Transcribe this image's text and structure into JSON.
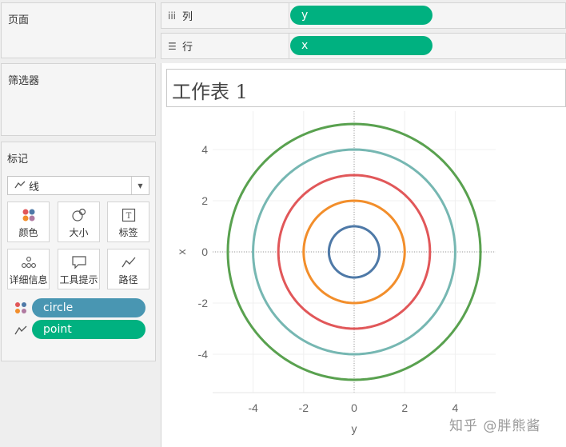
{
  "pages_card": {
    "title": "页面"
  },
  "filters_card": {
    "title": "筛选器"
  },
  "marks_card": {
    "title": "标记",
    "mark_type": "线",
    "mark_type_icon": "line-icon",
    "buttons": [
      {
        "label": "颜色",
        "icon": "color-dots-icon"
      },
      {
        "label": "大小",
        "icon": "size-icon"
      },
      {
        "label": "标签",
        "icon": "label-icon"
      },
      {
        "label": "详细信息",
        "icon": "detail-icon"
      },
      {
        "label": "工具提示",
        "icon": "tooltip-icon"
      },
      {
        "label": "路径",
        "icon": "path-icon"
      }
    ],
    "fields": [
      {
        "label": "circle",
        "icon": "color-dots-icon",
        "color": "#4996b2"
      },
      {
        "label": "point",
        "icon": "path-icon",
        "color": "#00b180"
      }
    ]
  },
  "shelves": {
    "columns": {
      "label": "列",
      "icon": "columns-icon",
      "pill": "y"
    },
    "rows": {
      "label": "行",
      "icon": "rows-icon",
      "pill": "x"
    }
  },
  "sheet": {
    "title": "工作表 1"
  },
  "chart_data": {
    "type": "line",
    "xlabel": "y",
    "ylabel": "x",
    "xlim": [
      -5.6,
      5.6
    ],
    "ylim": [
      -5.5,
      5.5
    ],
    "xticks": [
      -4,
      -2,
      0,
      2,
      4
    ],
    "yticks": [
      4,
      2,
      0,
      -2,
      -4
    ],
    "grid": true,
    "series": [
      {
        "radius": 1,
        "color": "#4e79a7"
      },
      {
        "radius": 2,
        "color": "#f28e2b"
      },
      {
        "radius": 3,
        "color": "#e15759"
      },
      {
        "radius": 4,
        "color": "#76b7b2"
      },
      {
        "radius": 5,
        "color": "#59a14f"
      }
    ]
  },
  "watermark": "知乎 @胖熊酱"
}
